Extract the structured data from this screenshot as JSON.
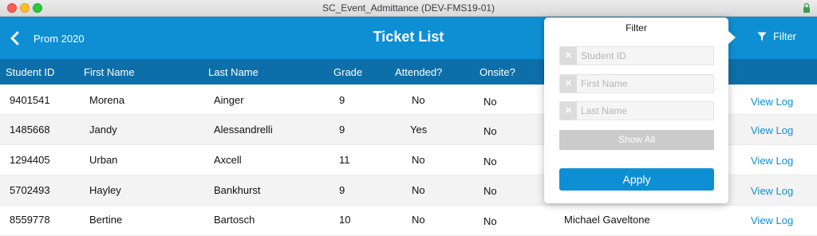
{
  "window": {
    "title": "SC_Event_Admittance (DEV-FMS19-01)"
  },
  "header": {
    "back_label": "Prom 2020",
    "title": "Ticket List",
    "filter_label": "Filter"
  },
  "columns": {
    "student_id": "Student ID",
    "first_name": "First Name",
    "last_name": "Last Name",
    "grade": "Grade",
    "attended": "Attended?",
    "onsite": "Onsite?"
  },
  "rows": [
    {
      "student_id": "9401541",
      "first_name": "Morena",
      "last_name": "Ainger",
      "grade": "9",
      "attended": "No",
      "onsite": "No",
      "name": "",
      "action": "View Log"
    },
    {
      "student_id": "1485668",
      "first_name": "Jandy",
      "last_name": "Alessandrelli",
      "grade": "9",
      "attended": "Yes",
      "onsite": "No",
      "name": "",
      "action": "View Log"
    },
    {
      "student_id": "1294405",
      "first_name": "Urban",
      "last_name": "Axcell",
      "grade": "11",
      "attended": "No",
      "onsite": "No",
      "name": "",
      "action": "View Log"
    },
    {
      "student_id": "5702493",
      "first_name": "Hayley",
      "last_name": "Bankhurst",
      "grade": "9",
      "attended": "No",
      "onsite": "No",
      "name": "",
      "action": "View Log"
    },
    {
      "student_id": "8559778",
      "first_name": "Bertine",
      "last_name": "Bartosch",
      "grade": "10",
      "attended": "No",
      "onsite": "No",
      "name": "Michael Gaveltone",
      "action": "View Log"
    }
  ],
  "filter_popover": {
    "title": "Filter",
    "fields": [
      {
        "placeholder": "Student ID",
        "value": ""
      },
      {
        "placeholder": "First Name",
        "value": ""
      },
      {
        "placeholder": "Last Name",
        "value": ""
      }
    ],
    "show_all_label": "Show All",
    "apply_label": "Apply"
  },
  "colors": {
    "header_blue": "#0e8fd4",
    "column_header_blue": "#0d6fa9",
    "link_blue": "#0e8fd4"
  }
}
